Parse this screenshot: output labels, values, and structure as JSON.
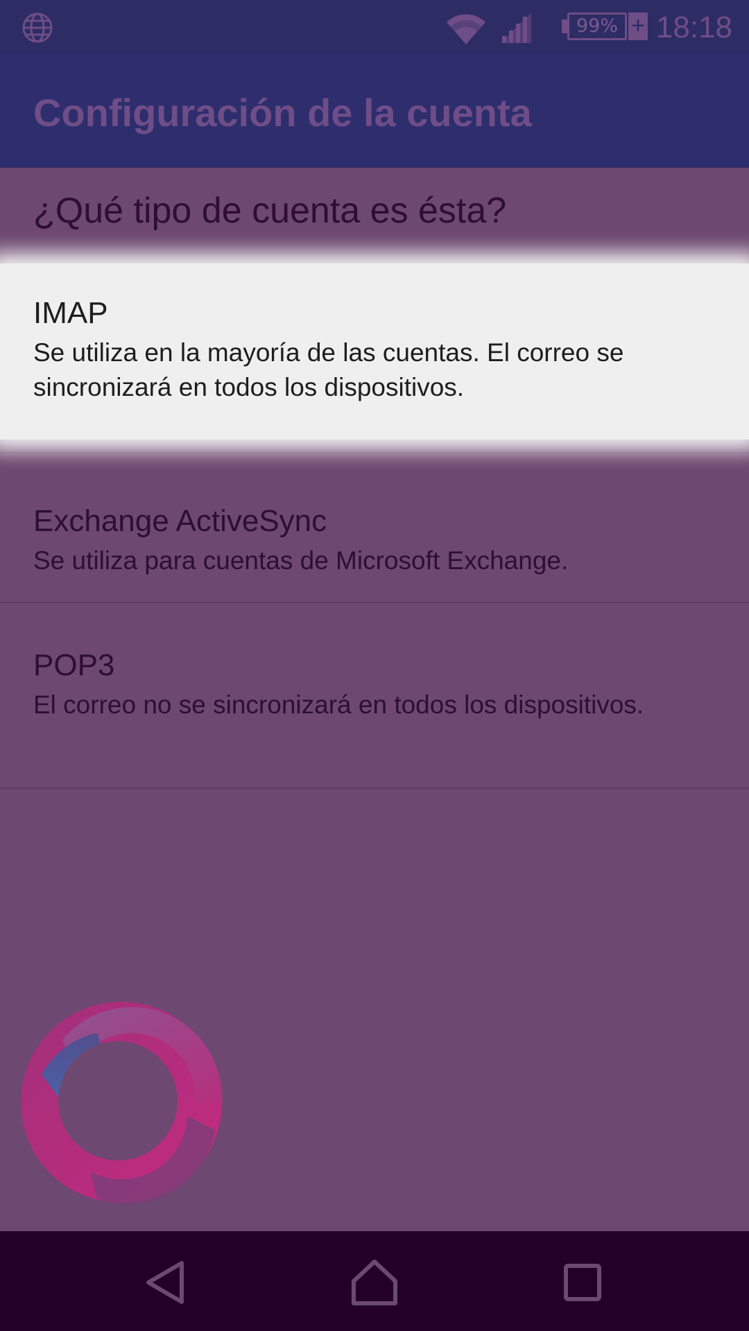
{
  "status_bar": {
    "time": "18:18",
    "battery_percent": "99%",
    "battery_charging_symbol": "+",
    "icons": [
      "globe-icon",
      "wifi-icon",
      "cell-signal-icon",
      "battery-icon"
    ]
  },
  "app_bar": {
    "title": "Configuración de la cuenta"
  },
  "dialog": {
    "question": "¿Qué tipo de cuenta es ésta?",
    "options": [
      {
        "title": "IMAP",
        "description": "Se utiliza en la mayoría de las cuentas. El correo se sincronizará en todos los dispositivos.",
        "highlighted": true
      },
      {
        "title": "Exchange ActiveSync",
        "description": "Se utiliza para cuentas de Microsoft Exchange.",
        "highlighted": false
      },
      {
        "title": "POP3",
        "description": "El correo no se sincronizará en todos los dispositivos.",
        "highlighted": false
      }
    ]
  },
  "nav_bar": {
    "icons": [
      "back-icon",
      "home-icon",
      "recent-apps-icon"
    ]
  },
  "colors": {
    "status_bar_bg": "#2e2c64",
    "app_bar_bg": "#2e2e6e",
    "dim_overlay": "#6d4870",
    "highlight_bg": "#efefef",
    "nav_bar_bg": "#230028",
    "accent_magenta": "#c0287a"
  }
}
